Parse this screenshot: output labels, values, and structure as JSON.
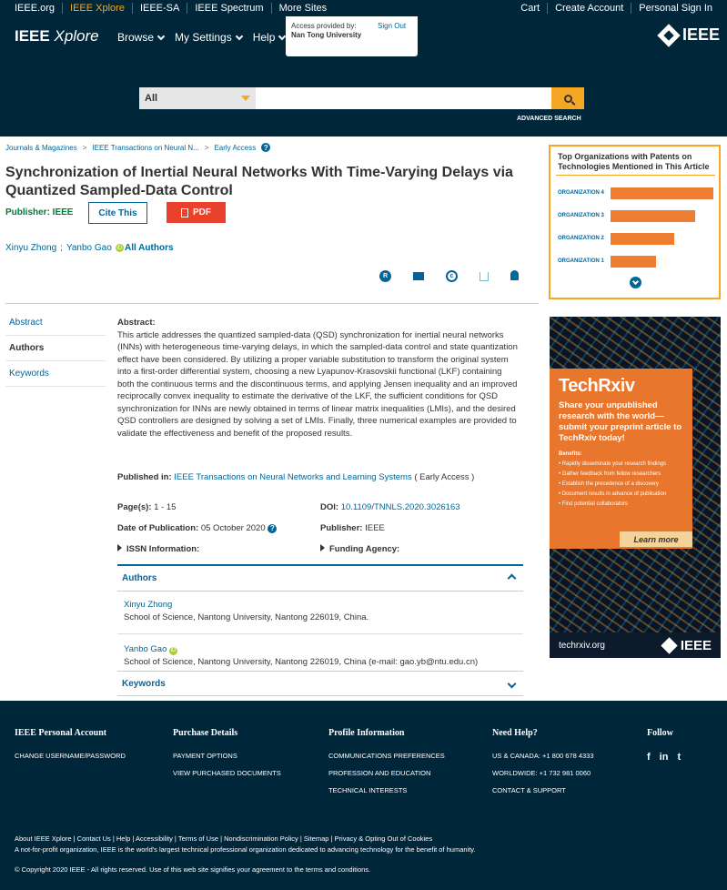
{
  "metabar": {
    "left": [
      "IEEE.org",
      "IEEE Xplore",
      "IEEE-SA",
      "IEEE Spectrum",
      "More Sites"
    ],
    "right": [
      "Cart",
      "Create Account",
      "Personal Sign In"
    ]
  },
  "header": {
    "logo_main": "IEEE",
    "logo_italic": "Xplore",
    "nav": [
      "Browse",
      "My Settings",
      "Help"
    ],
    "access_label": "Access provided by:",
    "institution": "Nan Tong University",
    "sign_out": "Sign Out",
    "ieee_logo": "IEEE"
  },
  "search": {
    "scope": "All",
    "placeholder": "",
    "advanced": "ADVANCED SEARCH"
  },
  "breadcrumb": [
    "Journals & Magazines",
    "IEEE Transactions on Neural N...",
    "Early Access"
  ],
  "article": {
    "title": "Synchronization of Inertial Neural Networks With Time-Varying Delays via Quantized Sampled-Data Control",
    "publisher_label": "Publisher: IEEE",
    "cite": "Cite This",
    "pdf": "PDF",
    "authors": [
      "Xinyu Zhong",
      "Yanbo Gao"
    ],
    "all_authors": "All Authors"
  },
  "tabs": [
    "Abstract",
    "Authors",
    "Keywords"
  ],
  "abstract": {
    "heading": "Abstract:",
    "text": "This article addresses the quantized sampled-data (QSD) synchronization for inertial neural networks (INNs) with heterogeneous time-varying delays, in which the sampled-data control and state quantization effect have been considered. By utilizing a proper variable substitution to transform the original system into a first-order differential system, choosing a new Lyapunov-Krasovskii functional (LKF) containing both the continuous terms and the discontinuous terms, and applying Jensen inequality and an improved reciprocally convex inequality to estimate the derivative of the LKF, the sufficient conditions for QSD synchronization for INNs are newly obtained in terms of linear matrix inequalities (LMIs), and the desired QSD controllers are designed by solving a set of LMIs. Finally, three numerical examples are provided to validate the effectiveness and benefit of the proposed results."
  },
  "meta": {
    "published_in_label": "Published in:",
    "journal": "IEEE Transactions on Neural Networks and Learning Systems",
    "journal_suffix": "( Early Access )",
    "pages_label": "Page(s):",
    "pages": "1 - 15",
    "doi_label": "DOI:",
    "doi": "10.1109/TNNLS.2020.3026163",
    "date_label": "Date of Publication:",
    "date": "05 October 2020",
    "publisher_label": "Publisher:",
    "publisher": "IEEE",
    "issn_label": "ISSN Information:",
    "funding_label": "Funding Agency:"
  },
  "authors_panel": {
    "heading": "Authors",
    "list": [
      {
        "name": "Xinyu Zhong",
        "affil": "School of Science, Nantong University, Nantong 226019, China."
      },
      {
        "name": "Yanbo Gao",
        "affil": "School of Science, Nantong University, Nantong 226019, China (e-mail: gao.yb@ntu.edu.cn)"
      }
    ],
    "keywords_heading": "Keywords"
  },
  "orgs": {
    "title": "Top Organizations with Patents on Technologies Mentioned in This Article",
    "items": [
      {
        "label": "ORGANIZATION 4",
        "value": 100
      },
      {
        "label": "ORGANIZATION 3",
        "value": 82
      },
      {
        "label": "ORGANIZATION 2",
        "value": 62
      },
      {
        "label": "ORGANIZATION 1",
        "value": 44
      }
    ]
  },
  "ad": {
    "brand": "TechRxiv",
    "tagline": "Share your unpublished research with the world—submit your preprint article to TechRxiv today!",
    "benefits_heading": "Benefits:",
    "benefits": [
      "Rapidly disseminate your research findings",
      "Gather feedback from fellow researchers",
      "Establish the precedence of a discovery",
      "Document results in advance of publication",
      "Find potential collaborators"
    ],
    "learn_more": "Learn more",
    "site": "techrxiv.org",
    "ieee": "IEEE"
  },
  "footer": {
    "col1": {
      "heading": "IEEE Personal Account",
      "items": [
        "CHANGE USERNAME/PASSWORD"
      ]
    },
    "col2": {
      "heading": "Purchase Details",
      "items": [
        "PAYMENT OPTIONS",
        "VIEW PURCHASED DOCUMENTS"
      ]
    },
    "col3": {
      "heading": "Profile Information",
      "items": [
        "COMMUNICATIONS PREFERENCES",
        "PROFESSION AND EDUCATION",
        "TECHNICAL INTERESTS"
      ]
    },
    "col4": {
      "heading": "Need Help?",
      "items": [
        "US & CANADA: +1 800 678 4333",
        "WORLDWIDE: +1 732 981 0060",
        "CONTACT & SUPPORT"
      ]
    },
    "col5": {
      "heading": "Follow"
    },
    "links": "About IEEE Xplore | Contact Us | Help | Accessibility | Terms of Use | Nondiscrimination Policy | Sitemap | Privacy & Opting Out of Cookies",
    "note": "A not-for-profit organization, IEEE is the world's largest technical professional organization dedicated to advancing technology for the benefit of humanity.",
    "copyright": "© Copyright 2020 IEEE - All rights reserved. Use of this web site signifies your agreement to the terms and conditions."
  }
}
